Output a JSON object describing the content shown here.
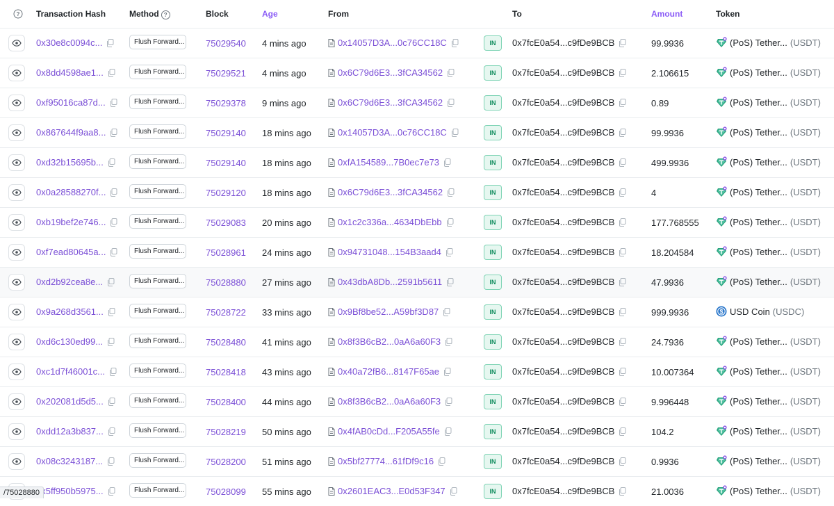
{
  "columns": {
    "help_icon": "question-circle-icon",
    "tx_hash": "Transaction Hash",
    "method": "Method",
    "block": "Block",
    "age": "Age",
    "from": "From",
    "to": "To",
    "amount": "Amount",
    "token": "Token"
  },
  "colors": {
    "link": "#7b4fd6",
    "accent_header": "#8b5cf6",
    "in_badge": "#0c8a5b"
  },
  "status_bar": "/75028880",
  "rows": [
    {
      "hash": "0x30e8c0094c...",
      "method": "Flush Forward...",
      "block": "75029540",
      "age": "4 mins ago",
      "from": "0x14057D3A...0c76CC18C",
      "from_contract": true,
      "direction": "IN",
      "to": "0x7fcE0a54...c9fDe9BCB",
      "amount": "99.9936",
      "token": "(PoS) Tether...",
      "symbol": "(USDT)",
      "token_icon": "tether-icon"
    },
    {
      "hash": "0x8dd4598ae1...",
      "method": "Flush Forward...",
      "block": "75029521",
      "age": "4 mins ago",
      "from": "0x6C79d6E3...3fCA34562",
      "from_contract": true,
      "direction": "IN",
      "to": "0x7fcE0a54...c9fDe9BCB",
      "amount": "2.106615",
      "token": "(PoS) Tether...",
      "symbol": "(USDT)",
      "token_icon": "tether-icon"
    },
    {
      "hash": "0xf95016ca87d...",
      "method": "Flush Forward...",
      "block": "75029378",
      "age": "9 mins ago",
      "from": "0x6C79d6E3...3fCA34562",
      "from_contract": true,
      "direction": "IN",
      "to": "0x7fcE0a54...c9fDe9BCB",
      "amount": "0.89",
      "token": "(PoS) Tether...",
      "symbol": "(USDT)",
      "token_icon": "tether-icon"
    },
    {
      "hash": "0x867644f9aa8...",
      "method": "Flush Forward...",
      "block": "75029140",
      "age": "18 mins ago",
      "from": "0x14057D3A...0c76CC18C",
      "from_contract": true,
      "direction": "IN",
      "to": "0x7fcE0a54...c9fDe9BCB",
      "amount": "99.9936",
      "token": "(PoS) Tether...",
      "symbol": "(USDT)",
      "token_icon": "tether-icon"
    },
    {
      "hash": "0xd32b15695b...",
      "method": "Flush Forward...",
      "block": "75029140",
      "age": "18 mins ago",
      "from": "0xfA154589...7B0ec7e73",
      "from_contract": true,
      "direction": "IN",
      "to": "0x7fcE0a54...c9fDe9BCB",
      "amount": "499.9936",
      "token": "(PoS) Tether...",
      "symbol": "(USDT)",
      "token_icon": "tether-icon"
    },
    {
      "hash": "0x0a28588270f...",
      "method": "Flush Forward...",
      "block": "75029120",
      "age": "18 mins ago",
      "from": "0x6C79d6E3...3fCA34562",
      "from_contract": true,
      "direction": "IN",
      "to": "0x7fcE0a54...c9fDe9BCB",
      "amount": "4",
      "token": "(PoS) Tether...",
      "symbol": "(USDT)",
      "token_icon": "tether-icon"
    },
    {
      "hash": "0xb19bef2e746...",
      "method": "Flush Forward...",
      "block": "75029083",
      "age": "20 mins ago",
      "from": "0x1c2c336a...4634DbEbb",
      "from_contract": true,
      "direction": "IN",
      "to": "0x7fcE0a54...c9fDe9BCB",
      "amount": "177.768555",
      "token": "(PoS) Tether...",
      "symbol": "(USDT)",
      "token_icon": "tether-icon"
    },
    {
      "hash": "0xf7ead80645a...",
      "method": "Flush Forward...",
      "block": "75028961",
      "age": "24 mins ago",
      "from": "0x94731048...154B3aad4",
      "from_contract": true,
      "direction": "IN",
      "to": "0x7fcE0a54...c9fDe9BCB",
      "amount": "18.204584",
      "token": "(PoS) Tether...",
      "symbol": "(USDT)",
      "token_icon": "tether-icon"
    },
    {
      "hash": "0xd2b92cea8e...",
      "method": "Flush Forward...",
      "block": "75028880",
      "age": "27 mins ago",
      "from": "0x43dbA8Db...2591b5611",
      "from_contract": true,
      "direction": "IN",
      "to": "0x7fcE0a54...c9fDe9BCB",
      "amount": "47.9936",
      "token": "(PoS) Tether...",
      "symbol": "(USDT)",
      "token_icon": "tether-icon",
      "highlighted": true
    },
    {
      "hash": "0x9a268d3561...",
      "method": "Flush Forward...",
      "block": "75028722",
      "age": "33 mins ago",
      "from": "0x9Bf8be52...A59bf3D87",
      "from_contract": true,
      "direction": "IN",
      "to": "0x7fcE0a54...c9fDe9BCB",
      "amount": "999.9936",
      "token": "USD Coin",
      "symbol": "(USDC)",
      "token_icon": "usdc-icon"
    },
    {
      "hash": "0xd6c130ed99...",
      "method": "Flush Forward...",
      "block": "75028480",
      "age": "41 mins ago",
      "from": "0x8f3B6cB2...0aA6a60F3",
      "from_contract": true,
      "direction": "IN",
      "to": "0x7fcE0a54...c9fDe9BCB",
      "amount": "24.7936",
      "token": "(PoS) Tether...",
      "symbol": "(USDT)",
      "token_icon": "tether-icon"
    },
    {
      "hash": "0xc1d7f46001c...",
      "method": "Flush Forward...",
      "block": "75028418",
      "age": "43 mins ago",
      "from": "0x40a72fB6...8147F65ae",
      "from_contract": true,
      "direction": "IN",
      "to": "0x7fcE0a54...c9fDe9BCB",
      "amount": "10.007364",
      "token": "(PoS) Tether...",
      "symbol": "(USDT)",
      "token_icon": "tether-icon"
    },
    {
      "hash": "0x202081d5d5...",
      "method": "Flush Forward...",
      "block": "75028400",
      "age": "44 mins ago",
      "from": "0x8f3B6cB2...0aA6a60F3",
      "from_contract": true,
      "direction": "IN",
      "to": "0x7fcE0a54...c9fDe9BCB",
      "amount": "9.996448",
      "token": "(PoS) Tether...",
      "symbol": "(USDT)",
      "token_icon": "tether-icon"
    },
    {
      "hash": "0xdd12a3b837...",
      "method": "Flush Forward...",
      "block": "75028219",
      "age": "50 mins ago",
      "from": "0x4fAB0cDd...F205A55fe",
      "from_contract": true,
      "direction": "IN",
      "to": "0x7fcE0a54...c9fDe9BCB",
      "amount": "104.2",
      "token": "(PoS) Tether...",
      "symbol": "(USDT)",
      "token_icon": "tether-icon"
    },
    {
      "hash": "0x08c3243187...",
      "method": "Flush Forward...",
      "block": "75028200",
      "age": "51 mins ago",
      "from": "0x5bf27774...61fDf9c16",
      "from_contract": true,
      "direction": "IN",
      "to": "0x7fcE0a54...c9fDe9BCB",
      "amount": "0.9936",
      "token": "(PoS) Tether...",
      "symbol": "(USDT)",
      "token_icon": "tether-icon"
    },
    {
      "hash": "0x5ff950b5975...",
      "method": "Flush Forward...",
      "block": "75028099",
      "age": "55 mins ago",
      "from": "0x2601EAC3...E0d53F347",
      "from_contract": true,
      "direction": "IN",
      "to": "0x7fcE0a54...c9fDe9BCB",
      "amount": "21.0036",
      "token": "(PoS) Tether...",
      "symbol": "(USDT)",
      "token_icon": "tether-icon"
    }
  ]
}
